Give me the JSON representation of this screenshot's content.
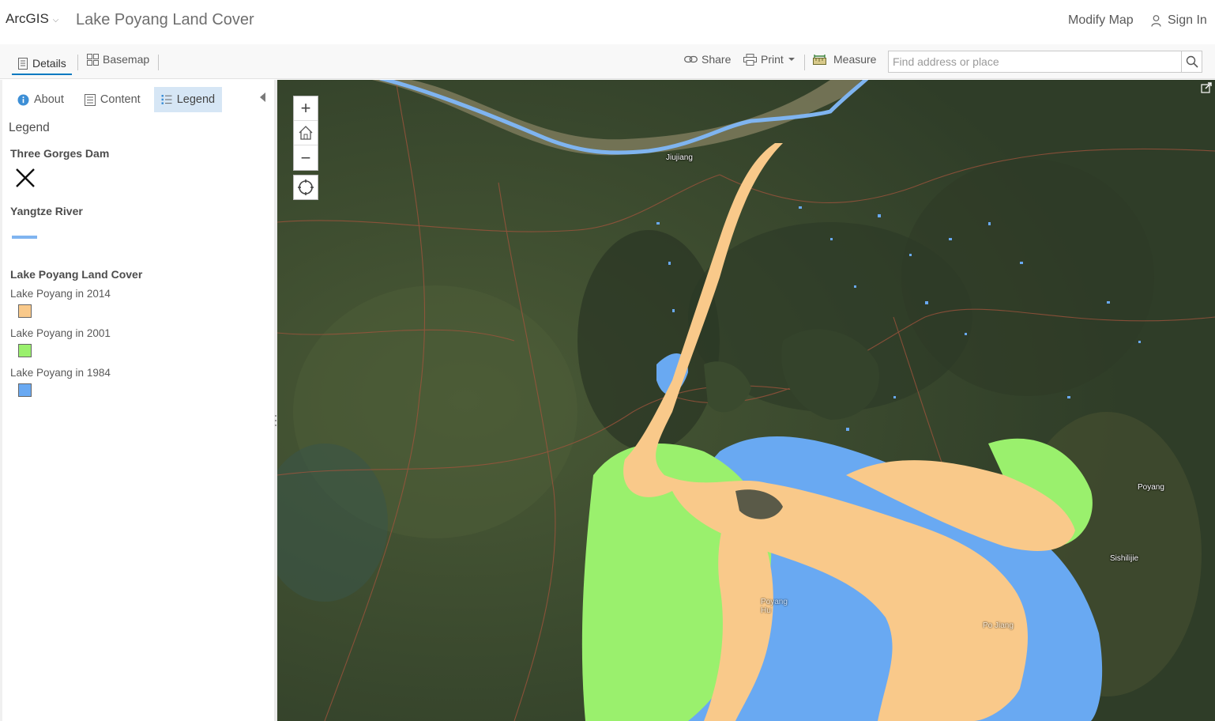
{
  "header": {
    "brand": "ArcGIS",
    "title": "Lake Poyang Land Cover",
    "modify_map": "Modify Map",
    "sign_in": "Sign In"
  },
  "toolbar": {
    "details": "Details",
    "basemap": "Basemap",
    "share": "Share",
    "print": "Print",
    "measure": "Measure",
    "search_placeholder": "Find address or place"
  },
  "panel": {
    "tabs": {
      "about": "About",
      "content": "Content",
      "legend": "Legend"
    },
    "active_tab": "Legend",
    "legend_heading": "Legend",
    "layers": [
      {
        "title": "Three Gorges Dam",
        "symbol": "x-marker-icon"
      },
      {
        "title": "Yangtze River",
        "symbol": "line",
        "color": "#7fb4f0"
      },
      {
        "title": "Lake Poyang Land Cover",
        "classes": [
          {
            "label": "Lake Poyang in 2014",
            "color": "#f9c98a"
          },
          {
            "label": "Lake Poyang in 2001",
            "color": "#9af06d"
          },
          {
            "label": "Lake Poyang in 1984",
            "color": "#69a9f2"
          }
        ]
      }
    ]
  },
  "map": {
    "labels": {
      "jiujiang": "Jiujiang",
      "poyang": "Poyang",
      "sishilijie": "Sishilijie",
      "poyang_hu": "Poyang Hu",
      "pojiang": "Po Jiang"
    },
    "controls": [
      "zoom-in",
      "home",
      "zoom-out",
      "locate"
    ]
  },
  "colors": {
    "accent": "#0079c1",
    "active_tab_bg": "#d6e6f5",
    "imagery_dark": "#34432b",
    "river": "#7fb4f0"
  }
}
